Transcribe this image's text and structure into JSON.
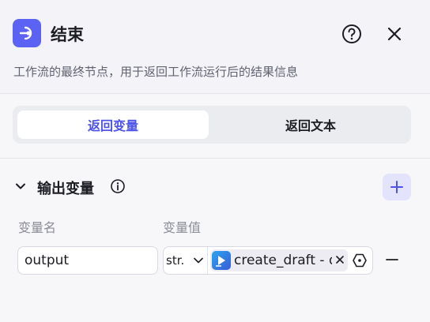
{
  "header": {
    "title": "结束",
    "description": "工作流的最终节点，用于返回工作流运行后的结果信息",
    "icons": {
      "node": "end-node-icon",
      "help": "question-circle-icon",
      "close": "close-icon"
    },
    "accent_color": "#5c62f3"
  },
  "tabs": [
    {
      "label": "返回变量",
      "active": true
    },
    {
      "label": "返回文本",
      "active": false
    }
  ],
  "output_section": {
    "title": "输出变量",
    "columns": {
      "name": "变量名",
      "value": "变量值"
    },
    "rows": [
      {
        "name": "output",
        "type": "str.",
        "reference": "create_draft - d"
      }
    ]
  }
}
